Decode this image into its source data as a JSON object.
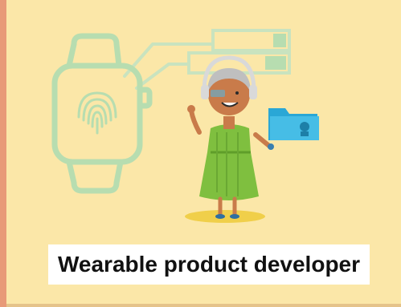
{
  "card": {
    "caption": "Wearable product developer"
  },
  "illustration": {
    "subjects": [
      "smartwatch-icon",
      "fingerprint-icon",
      "folder-icon",
      "developer-avatar",
      "headset-icon",
      "progress-bars"
    ],
    "colors": {
      "background": "#fbe7a8",
      "accent_left": "#e89a78",
      "watch_outline": "#b7ddb0",
      "folder": "#2aa7d6",
      "dress": "#7fbf3f",
      "skin": "#c97b4a",
      "shadow": "#f0cf4a"
    }
  }
}
